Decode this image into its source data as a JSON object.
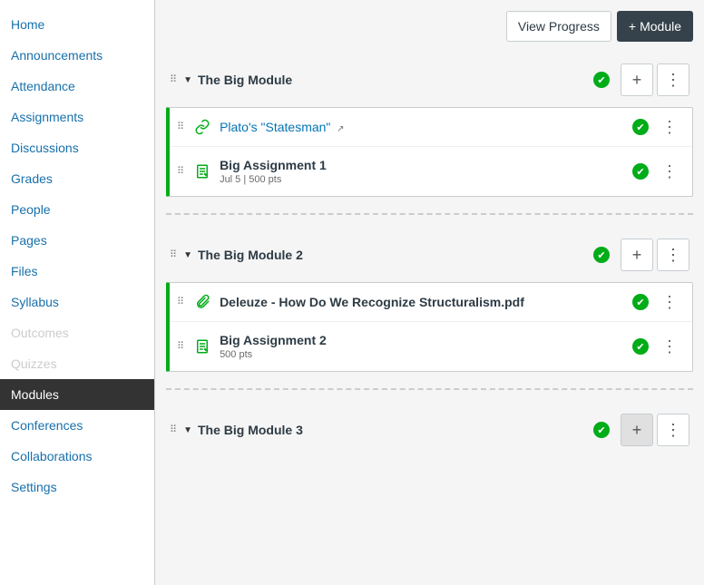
{
  "top_buttons": {
    "view_progress": "View Progress",
    "add_module": "Module"
  },
  "sidebar": {
    "items": [
      {
        "label": "Home",
        "active": false,
        "disabled": false
      },
      {
        "label": "Announcements",
        "active": false,
        "disabled": false
      },
      {
        "label": "Attendance",
        "active": false,
        "disabled": false
      },
      {
        "label": "Assignments",
        "active": false,
        "disabled": false
      },
      {
        "label": "Discussions",
        "active": false,
        "disabled": false
      },
      {
        "label": "Grades",
        "active": false,
        "disabled": false
      },
      {
        "label": "People",
        "active": false,
        "disabled": false
      },
      {
        "label": "Pages",
        "active": false,
        "disabled": false
      },
      {
        "label": "Files",
        "active": false,
        "disabled": false
      },
      {
        "label": "Syllabus",
        "active": false,
        "disabled": false
      },
      {
        "label": "Outcomes",
        "active": false,
        "disabled": true
      },
      {
        "label": "Quizzes",
        "active": false,
        "disabled": true
      },
      {
        "label": "Modules",
        "active": true,
        "disabled": false
      },
      {
        "label": "Conferences",
        "active": false,
        "disabled": false
      },
      {
        "label": "Collaborations",
        "active": false,
        "disabled": false
      },
      {
        "label": "Settings",
        "active": false,
        "disabled": false
      }
    ]
  },
  "modules": [
    {
      "title": "The Big Module",
      "published": true,
      "add_hover": false,
      "items": [
        {
          "icon": "link",
          "title": "Plato's \"Statesman\"",
          "link": true,
          "external": true,
          "meta": "",
          "published": true
        },
        {
          "icon": "assignment",
          "title": "Big Assignment 1",
          "link": false,
          "external": false,
          "meta": "Jul 5  |  500 pts",
          "published": true
        }
      ]
    },
    {
      "title": "The Big Module 2",
      "published": true,
      "add_hover": false,
      "items": [
        {
          "icon": "attachment",
          "title": "Deleuze - How Do We Recognize Structuralism.pdf",
          "link": false,
          "external": false,
          "meta": "",
          "published": true
        },
        {
          "icon": "assignment",
          "title": "Big Assignment 2",
          "link": false,
          "external": false,
          "meta": "500 pts",
          "published": true
        }
      ]
    },
    {
      "title": "The Big Module 3",
      "published": true,
      "add_hover": true,
      "items": []
    }
  ]
}
